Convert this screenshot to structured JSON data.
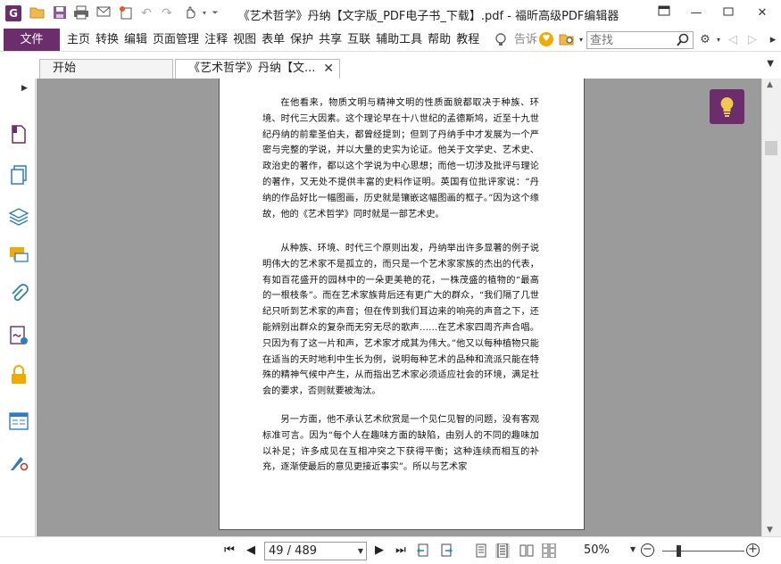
{
  "app": {
    "window_title": "《艺术哲学》丹纳【文字版_PDF电子书_下载】.pdf - 福昕高级PDF编辑器",
    "logo_letter": "G",
    "accent_color": "#6b2d6b"
  },
  "menu": {
    "file_label": "文件",
    "items": [
      "主页",
      "转换",
      "编辑",
      "页面管理",
      "注释",
      "视图",
      "表单",
      "保护",
      "共享",
      "互联",
      "辅助工具",
      "帮助",
      "教程"
    ],
    "tell_me": "告诉",
    "search_placeholder": "查找"
  },
  "tabs": [
    {
      "label": "开始"
    },
    {
      "label": "《艺术哲学》丹纳【文..."
    }
  ],
  "document": {
    "paragraphs": [
      "在他看来，物质文明与精神文明的性质面貌都取决于种族、环境、时代三大因素。这个理论早在十八世纪的孟德斯鸠，近至十九世纪丹纳的前辈圣伯夫，都曾经提到；但到了丹纳手中才发展为一个严密与完整的学说，并以大量的史实为论证。他关于文学史、艺术史、政治史的著作，都以这个学说为中心思想；而他一切涉及批评与理论的著作，又无处不提供丰富的史料作证明。英国有位批评家说：“丹纳的作品好比一幅图画，历史就是镶嵌这幅图画的框子。”因为这个缘故，他的《艺术哲学》同时就是一部艺术史。",
      "从种族、环境、时代三个原则出发，丹纳举出许多显著的例子说明伟大的艺术家不是孤立的，而只是一个艺术家家族的杰出的代表，有如百花盛开的园林中的一朵更美艳的花，一株茂盛的植物的“最高的一根枝条”。而在艺术家族背后还有更广大的群众，“我们隔了几世纪只听到艺术家的声音；但在传到我们耳边来的响亮的声音之下，还能辨别出群众的复杂而无穷无尽的歌声……在艺术家四周齐声合唱。只因为有了这一片和声，艺术家才成其为伟大。”他又以每种植物只能在适当的天时地利中生长为例，说明每种艺术的品种和流派只能在特殊的精神气候中产生，从而指出艺术家必须适应社会的环境，满足社会的要求，否则就要被淘汰。",
      "另一方面，他不承认艺术欣赏是一个见仁见智的问题，没有客观标准可言。因为“每个人在趣味方面的缺陷，由别人的不同的趣味加以补足；许多成见在互相冲突之下获得平衡；这种连续而相互的补充，逐渐使最后的意见更接近事实”。所以与艺术家"
    ]
  },
  "status": {
    "page_display": "49 / 489",
    "zoom": "50%"
  }
}
